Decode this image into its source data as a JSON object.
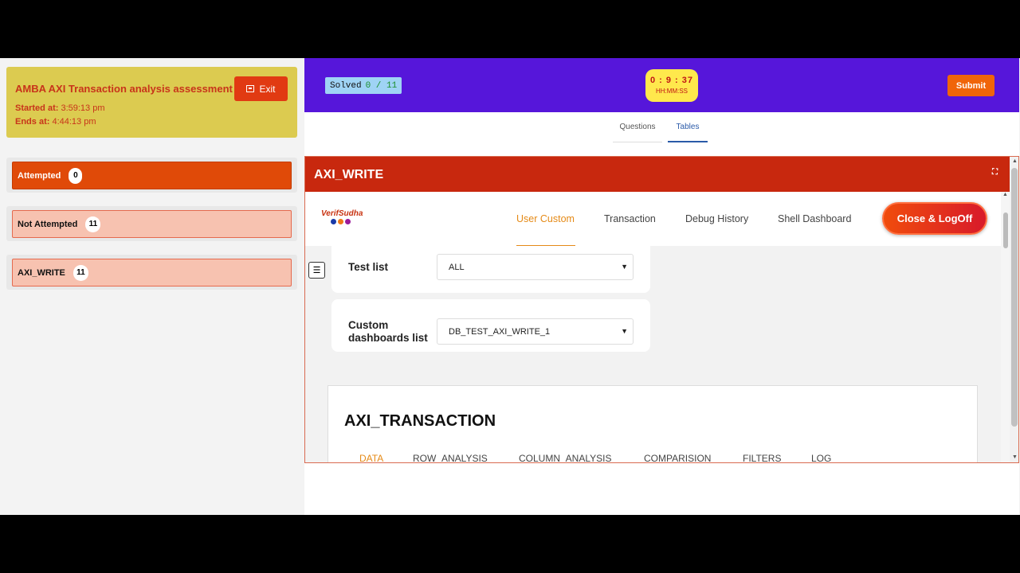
{
  "assessment": {
    "title": "AMBA AXI Transaction analysis assessment",
    "started_label": "Started at:",
    "started_value": "3:59:13 pm",
    "ends_label": "Ends at:",
    "ends_value": "4:44:13 pm",
    "exit_label": "Exit"
  },
  "stats": [
    {
      "label": "Attempted",
      "count": "0"
    },
    {
      "label": "Not Attempted",
      "count": "11"
    },
    {
      "label": "AXI_WRITE",
      "count": "11"
    }
  ],
  "topbar": {
    "solved_label": "Solved",
    "solved_value": "0 / 11",
    "timer_value": "0 : 9 : 37",
    "timer_format": "HH:MM:SS",
    "submit_label": "Submit",
    "bg_color": "#5616da"
  },
  "tabs": [
    {
      "label": "Questions"
    },
    {
      "label": "Tables",
      "active": true
    }
  ],
  "panel": {
    "title": "AXI_WRITE",
    "logo_text": "VerifSudha",
    "nav": [
      {
        "label": "User Custom",
        "active": true
      },
      {
        "label": "Transaction"
      },
      {
        "label": "Debug History"
      },
      {
        "label": "Shell Dashboard"
      }
    ],
    "close_label": "Close & LogOff",
    "test_list_label": "Test list",
    "test_list_value": "ALL",
    "dash_label_line1": "Custom",
    "dash_label_line2": "dashboards list",
    "dash_value": "DB_TEST_AXI_WRITE_1",
    "tx_title": "AXI_TRANSACTION",
    "tx_tabs": [
      {
        "label": "DATA",
        "active": true
      },
      {
        "label": "ROW_ANALYSIS"
      },
      {
        "label": "COLUMN_ANALYSIS"
      },
      {
        "label": "COMPARISION"
      },
      {
        "label": "FILTERS"
      },
      {
        "label": "LOG"
      }
    ],
    "accent_color": "#e58a17",
    "header_color": "#c8280e"
  }
}
